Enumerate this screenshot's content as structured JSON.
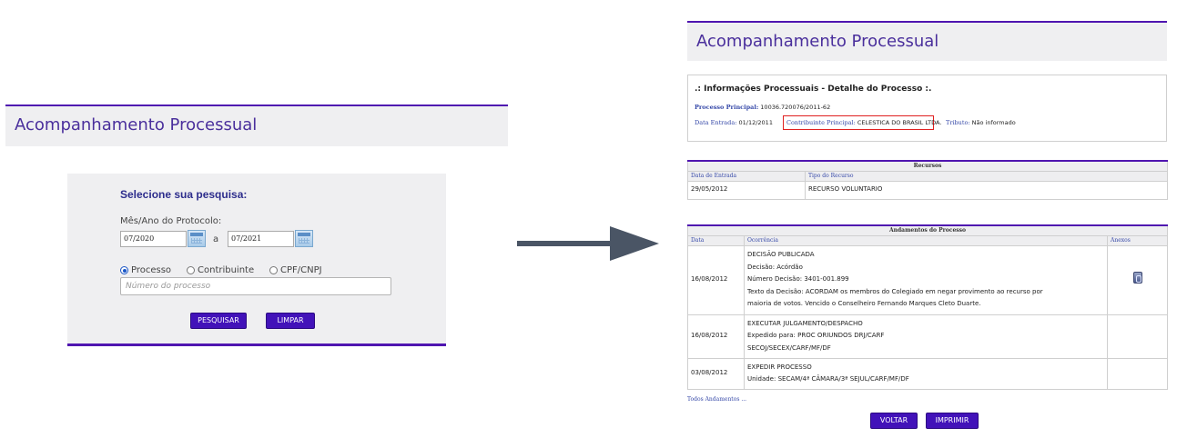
{
  "left": {
    "title": "Acompanhamento Processual",
    "heading": "Selecione sua pesquisa:",
    "period_label": "Mês/Ano do Protocolo:",
    "date_from": "07/2020",
    "date_sep": "a",
    "date_to": "07/2021",
    "radios": [
      {
        "label": "Processo",
        "checked": true
      },
      {
        "label": "Contribuinte",
        "checked": false
      },
      {
        "label": "CPF/CNPJ",
        "checked": false
      }
    ],
    "number_placeholder": "Número do processo",
    "search_button": "PESQUISAR",
    "clear_button": "LIMPAR"
  },
  "right": {
    "title": "Acompanhamento Processual",
    "info_title": ".: Informações Processuais - Detalhe do Processo :.",
    "processo_label": "Processo Principal:",
    "processo_value": "10036.720076/2011-62",
    "entrada_label": "Data Entrada:",
    "entrada_value": "01/12/2011",
    "contribuinte_label": "Contribuinte Principal:",
    "contribuinte_value": "CELESTICA DO BRASIL LTDA.",
    "tributo_label": "Tributo:",
    "tributo_value": "Não informado",
    "recursos": {
      "caption": "Recursos",
      "headers": [
        "Data de Entrada",
        "Tipo do Recurso"
      ],
      "rows": [
        [
          "29/05/2012",
          "RECURSO VOLUNTARIO"
        ]
      ]
    },
    "andamentos": {
      "caption": "Andamentos do Processo",
      "headers": [
        "Data",
        "Ocorrência",
        "Anexos"
      ],
      "rows": [
        {
          "date": "16/08/2012",
          "lines": [
            "DECISÃO PUBLICADA",
            "Decisão: Acórdão",
            "Número Decisão: 3401-001.899",
            "Texto da Decisão: ACORDAM os membros do Colegiado em negar provimento ao recurso por",
            "maioria de votos. Vencido o Conselheiro Fernando Marques Cleto Duarte."
          ],
          "has_attachment": true
        },
        {
          "date": "16/08/2012",
          "lines": [
            "EXECUTAR JULGAMENTO/DESPACHO",
            "Expedido para: PROC ORIUNDOS DRJ/CARF",
            "SECOJ/SECEX/CARF/MF/DF"
          ],
          "has_attachment": false
        },
        {
          "date": "03/08/2012",
          "lines": [
            "EXPEDIR PROCESSO",
            "Unidade: SECAM/4ª CÂMARA/3ª SEJUL/CARF/MF/DF"
          ],
          "has_attachment": false
        }
      ]
    },
    "all_link": "Todos Andamentos ...",
    "back_button": "VOLTAR",
    "print_button": "IMPRIMIR"
  },
  "icons": {
    "calendar": "calendar-icon",
    "attachment": "attachment-icon",
    "arrow": "right-arrow-icon"
  },
  "colors": {
    "accent": "#4f15b0",
    "button": "#4212b9",
    "title_text": "#4a2f9c",
    "highlight": "#e02020"
  }
}
